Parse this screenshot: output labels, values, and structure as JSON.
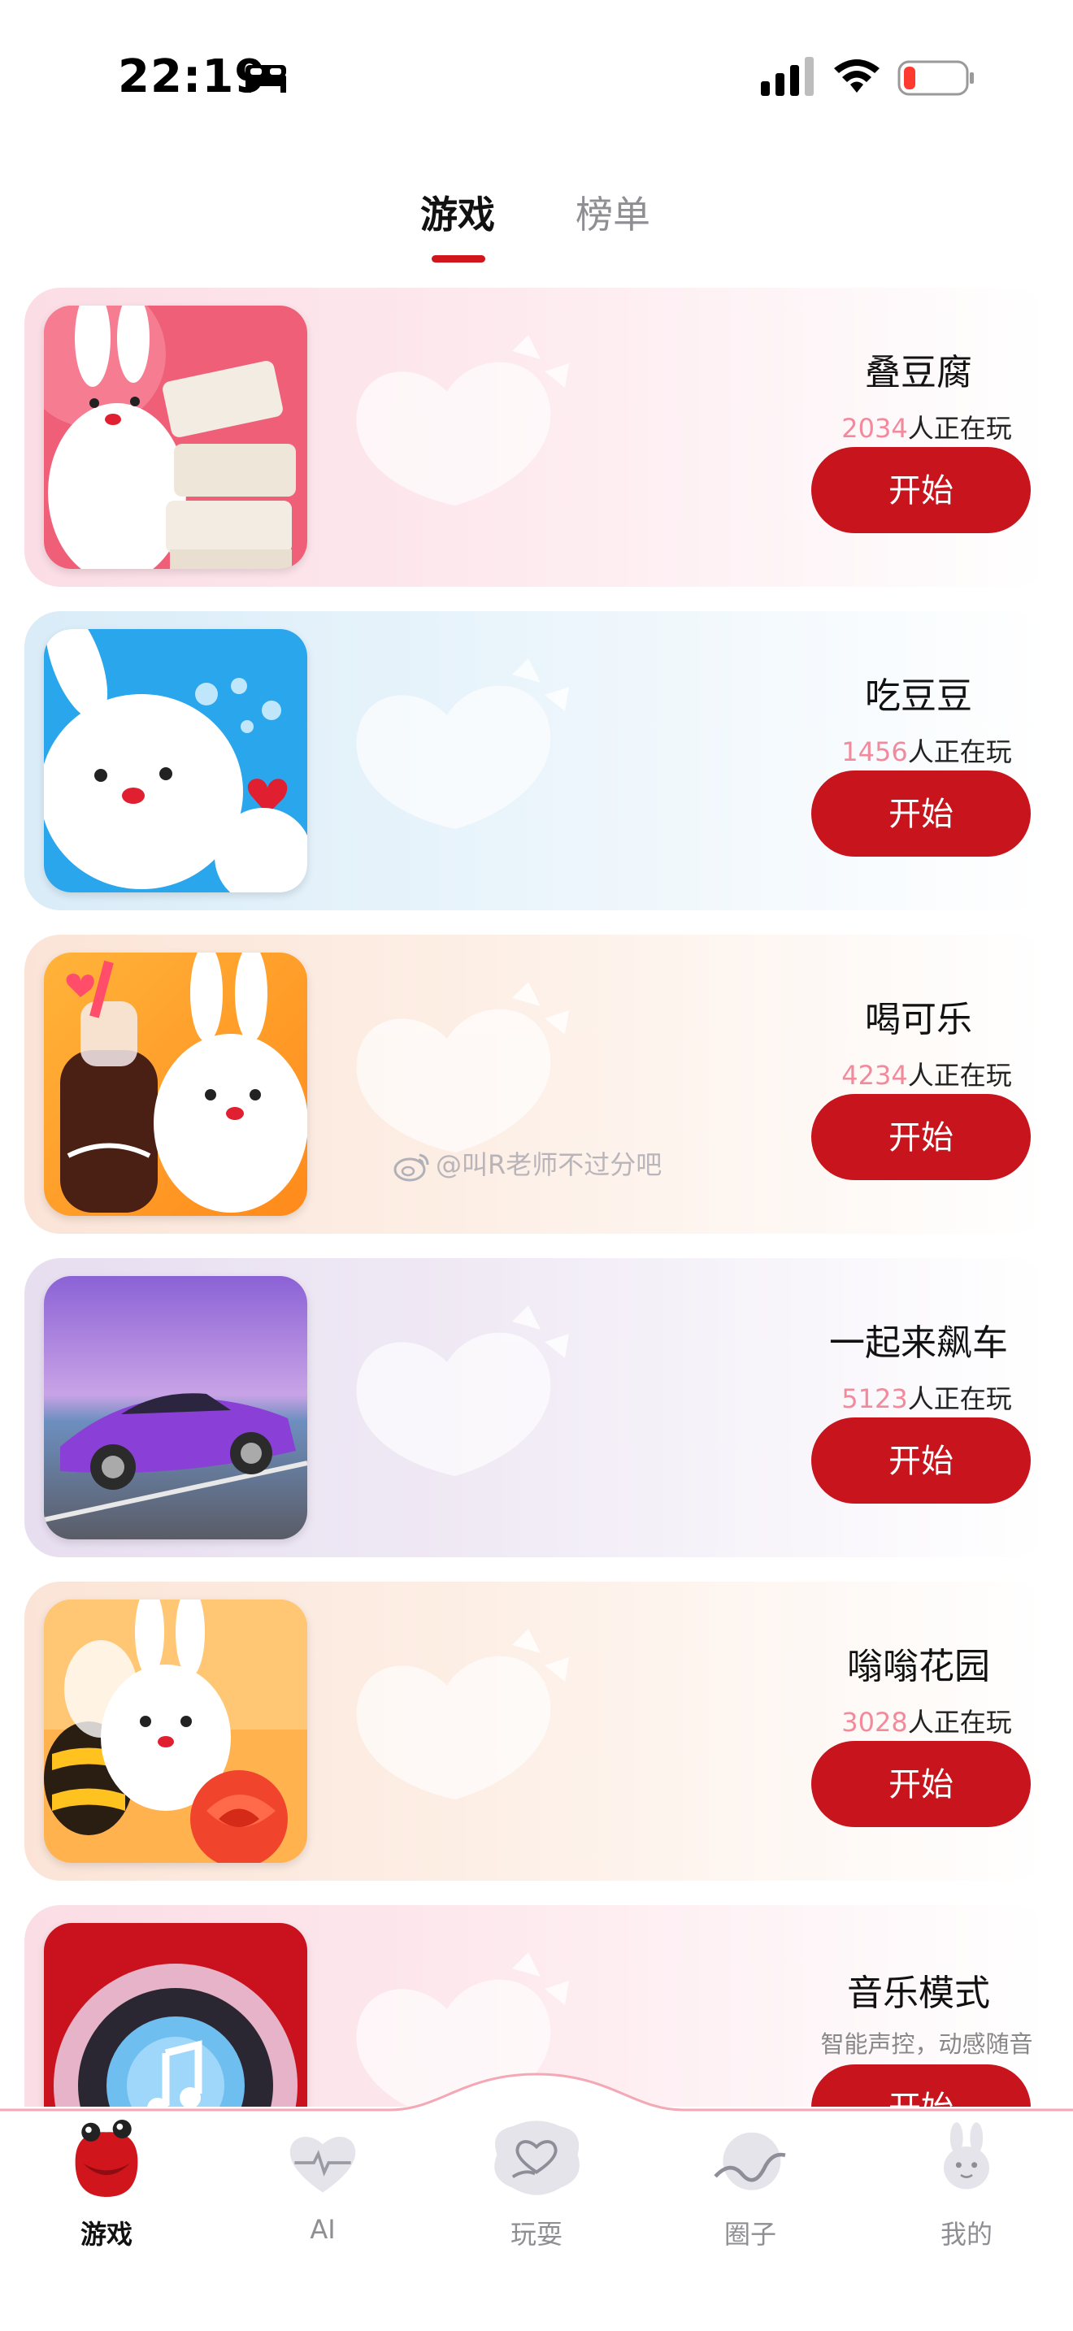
{
  "status_bar": {
    "time": "22:19",
    "icons": [
      "bed-icon",
      "signal-icon",
      "wifi-icon",
      "battery-low-icon"
    ]
  },
  "tabs": [
    {
      "label": "游戏",
      "active": true
    },
    {
      "label": "榜单",
      "active": false
    }
  ],
  "games": [
    {
      "title": "叠豆腐",
      "player_count": "2034",
      "player_suffix": "人正在玩",
      "button": "开始",
      "theme": "pink"
    },
    {
      "title": "吃豆豆",
      "player_count": "1456",
      "player_suffix": "人正在玩",
      "button": "开始",
      "theme": "blue"
    },
    {
      "title": "喝可乐",
      "player_count": "4234",
      "player_suffix": "人正在玩",
      "button": "开始",
      "theme": "peach"
    },
    {
      "title": "一起来飙车",
      "player_count": "5123",
      "player_suffix": "人正在玩",
      "button": "开始",
      "theme": "lavender"
    },
    {
      "title": "嗡嗡花园",
      "player_count": "3028",
      "player_suffix": "人正在玩",
      "button": "开始",
      "theme": "peach"
    },
    {
      "title": "音乐模式",
      "subtitle": "智能声控，动感随音",
      "button": "开始",
      "theme": "pink"
    }
  ],
  "watermark": "@叫R老师不过分吧",
  "bottom_nav": [
    {
      "label": "游戏",
      "icon": "lips-mascot-icon",
      "active": true
    },
    {
      "label": "AI",
      "icon": "heartbeat-icon",
      "active": false
    },
    {
      "label": "玩耍",
      "icon": "heart-badge-icon",
      "active": false
    },
    {
      "label": "圈子",
      "icon": "wave-circle-icon",
      "active": false
    },
    {
      "label": "我的",
      "icon": "bunny-icon",
      "active": false
    }
  ],
  "colors": {
    "accent": "#c8141c",
    "count_pink": "#f28a9c",
    "inactive_grey": "#8e8e93"
  }
}
